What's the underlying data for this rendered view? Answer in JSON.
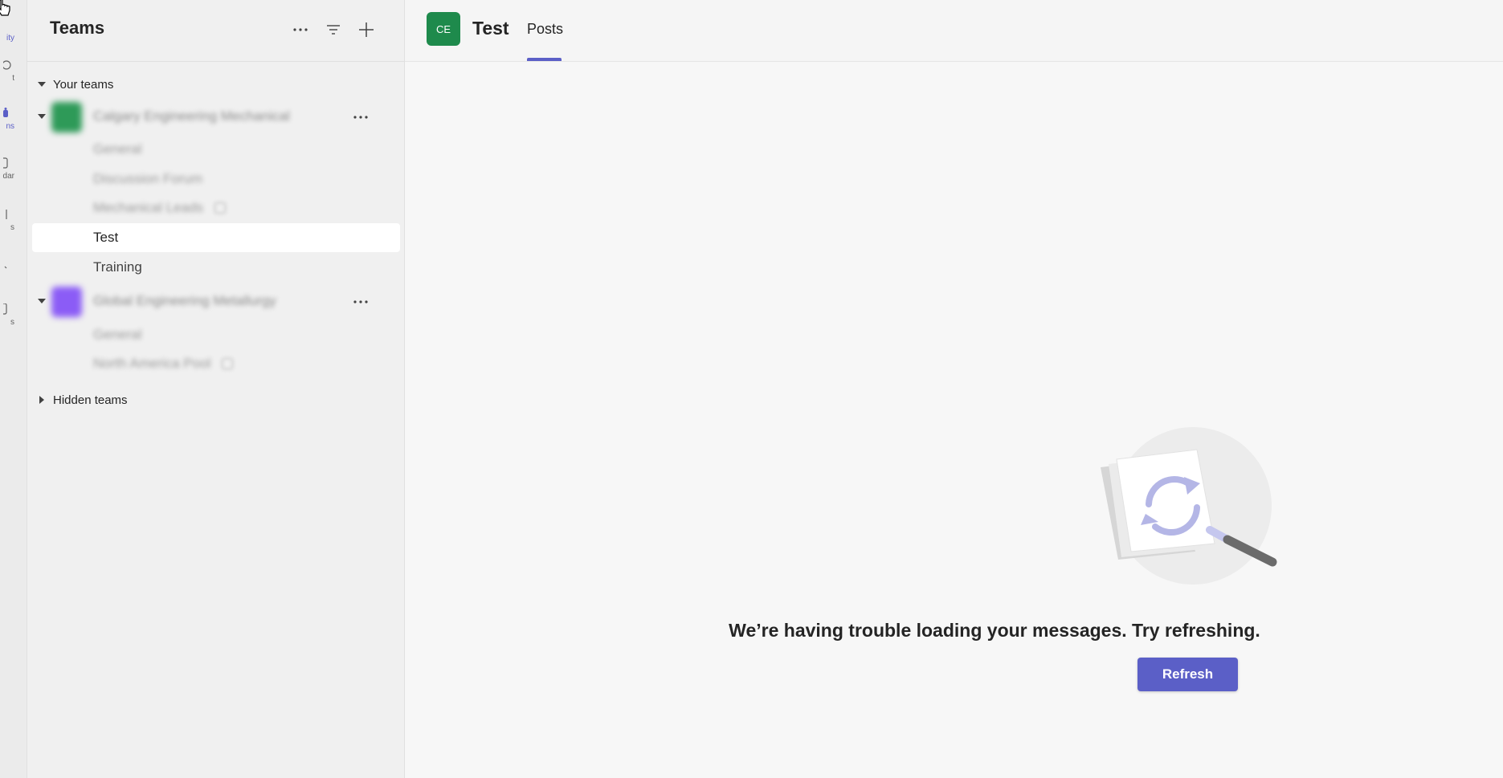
{
  "rail": {
    "items": [
      {
        "label": "ity",
        "icon": "bell-icon"
      },
      {
        "label": "t",
        "icon": "chat-icon"
      },
      {
        "label": "ns",
        "icon": "teams-icon"
      },
      {
        "label": "dar",
        "icon": "calendar-icon"
      },
      {
        "label": "s",
        "icon": "calls-icon"
      },
      {
        "label": "",
        "icon": "files-icon"
      },
      {
        "label": "s",
        "icon": "apps-icon"
      }
    ]
  },
  "pane": {
    "title": "Teams",
    "section_your_teams": "Your teams",
    "teams": [
      {
        "name": "Calgary Engineering Mechanical",
        "avatar_color": "#2e9a58",
        "channels": [
          "General",
          "Discussion Forum",
          "Mechanical Leads"
        ]
      },
      {
        "name": "Global Engineering Metallurgy",
        "avatar_color": "#8b5cf6",
        "channels": [
          "General",
          "North America Pool"
        ]
      }
    ],
    "selected_channel": "Test",
    "channel_training": "Training",
    "section_hidden_teams": "Hidden teams"
  },
  "main": {
    "avatar_initials": "CE",
    "avatar_color": "#1e8a4c",
    "channel_title": "Test",
    "tab_posts": "Posts",
    "error_message": "We’re having trouble loading your messages. Try refreshing.",
    "refresh_label": "Refresh",
    "accent_color": "#5b5fc7"
  }
}
